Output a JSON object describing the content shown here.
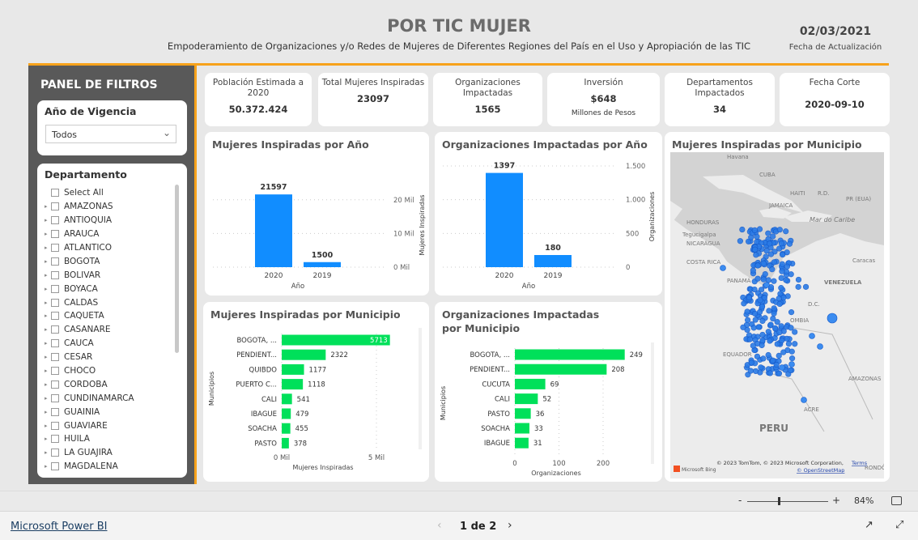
{
  "header": {
    "title": "POR TIC MUJER",
    "subtitle": "Empoderamiento de Organizaciones y/o Redes de Mujeres de Diferentes Regiones del País en el Uso y Apropiación de las TIC",
    "date": "02/03/2021",
    "date_label": "Fecha de Actualización"
  },
  "filters": {
    "title": "PANEL DE FILTROS",
    "year_label": "Año de Vigencia",
    "year_value": "Todos",
    "dept_label": "Departamento",
    "departments": [
      "Select All",
      "AMAZONAS",
      "ANTIOQUIA",
      "ARAUCA",
      "ATLANTICO",
      "BOGOTA",
      "BOLIVAR",
      "BOYACA",
      "CALDAS",
      "CAQUETA",
      "CASANARE",
      "CAUCA",
      "CESAR",
      "CHOCO",
      "CORDOBA",
      "CUNDINAMARCA",
      "GUAINIA",
      "GUAVIARE",
      "HUILA",
      "LA GUAJIRA",
      "MAGDALENA"
    ]
  },
  "cards": [
    {
      "label": "Población Estimada a 2020",
      "value": "50.372.424"
    },
    {
      "label": "Total Mujeres Inspiradas",
      "value": "23097"
    },
    {
      "label": "Organizaciones Impactadas",
      "value": "1565"
    },
    {
      "label": "Inversión",
      "value": "$648",
      "sub": "Millones de Pesos"
    },
    {
      "label": "Departamentos Impactados",
      "value": "34"
    },
    {
      "label": "Fecha Corte",
      "value": "2020-09-10"
    }
  ],
  "chart_data": [
    {
      "type": "bar",
      "title": "Mujeres Inspiradas por Año",
      "categories": [
        "2020",
        "2019"
      ],
      "values": [
        21597,
        1500
      ],
      "xlabel": "Año",
      "ylabel": "Mujeres Inspiradas",
      "yticks": [
        "0 Mil",
        "10 Mil",
        "20 Mil"
      ],
      "ylim": [
        0,
        25000
      ],
      "grid": true
    },
    {
      "type": "bar",
      "title": "Organizaciones Impactadas por Año",
      "categories": [
        "2020",
        "2019"
      ],
      "values": [
        1397,
        180
      ],
      "xlabel": "Año",
      "ylabel": "Organizaciones",
      "yticks": [
        "0",
        "500",
        "1.000",
        "1.500"
      ],
      "ylim": [
        0,
        1500
      ],
      "grid": true
    },
    {
      "type": "bar",
      "orientation": "horizontal",
      "title": "Mujeres Inspiradas por Municipio",
      "categories": [
        "BOGOTA, ...",
        "PENDIENT...",
        "QUIBDO",
        "PUERTO C...",
        "CALI",
        "IBAGUE",
        "SOACHA",
        "PASTO"
      ],
      "values": [
        5713,
        2322,
        1177,
        1118,
        541,
        479,
        455,
        378
      ],
      "xlabel": "Mujeres Inspiradas",
      "ylabel": "Municipios",
      "xticks": [
        "0 Mil",
        "5 Mil"
      ],
      "grid": true
    },
    {
      "type": "bar",
      "orientation": "horizontal",
      "title": "Organizaciones Impactadas por Municipio",
      "categories": [
        "BOGOTA, ...",
        "PENDIENT...",
        "CUCUTA",
        "CALI",
        "PASTO",
        "SOACHA",
        "IBAGUE"
      ],
      "values": [
        249,
        208,
        69,
        52,
        36,
        33,
        31
      ],
      "xlabel": "Organizaciones",
      "ylabel": "Municipios",
      "xticks": [
        "0",
        "100",
        "200"
      ],
      "grid": true
    }
  ],
  "colors": {
    "accent": "#f7a21b",
    "bar_blue": "#118dff",
    "bar_green": "#00e05a",
    "panel": "#595959"
  },
  "map": {
    "title": "Mujeres Inspiradas por Municipio",
    "labels": [
      "Havana",
      "CUBA",
      "HAITI",
      "R.D.",
      "JAMAICA",
      "PR (EUA)",
      "Mar do Caribe",
      "HONDURAS",
      "Tegucigalpa",
      "NICARÁGUA",
      "COSTA RICA",
      "Caracas",
      "PANAMÁ",
      "VENEZUELA",
      "D.C.",
      "OMBIA",
      "EQUADOR",
      "AMAZONAS",
      "ACRE",
      "PERU",
      "RONDÔNI"
    ],
    "attribution": "© 2023 TomTom, © 2023 Microsoft Corporation,",
    "terms": "Terms",
    "osm": "© OpenStreetMap",
    "bing": "Microsoft Bing"
  },
  "zoom": {
    "minus": "-",
    "plus": "+",
    "level": "84%"
  },
  "footer": {
    "brand": "Microsoft Power BI",
    "page": "1 de 2"
  }
}
